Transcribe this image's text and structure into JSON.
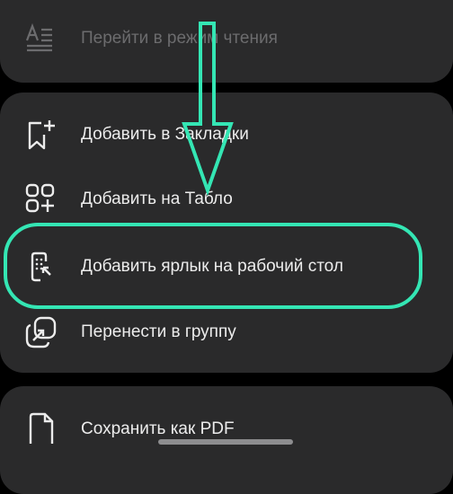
{
  "menu": {
    "reading_mode_label": "Перейти в режим чтения",
    "items": [
      {
        "label": "Добавить в Закладки",
        "icon": "bookmark-add-icon"
      },
      {
        "label": "Добавить на Табло",
        "icon": "grid-add-icon"
      },
      {
        "label": "Добавить ярлык на рабочий стол",
        "icon": "phone-shortcut-icon"
      },
      {
        "label": "Перенести в группу",
        "icon": "move-to-group-icon"
      }
    ],
    "save_pdf_label": "Сохранить как PDF"
  },
  "colors": {
    "background": "#000000",
    "card": "#2a2a2b",
    "text": "#ececec",
    "text_disabled": "#6c6c6e",
    "annotation": "#34e6b4"
  }
}
